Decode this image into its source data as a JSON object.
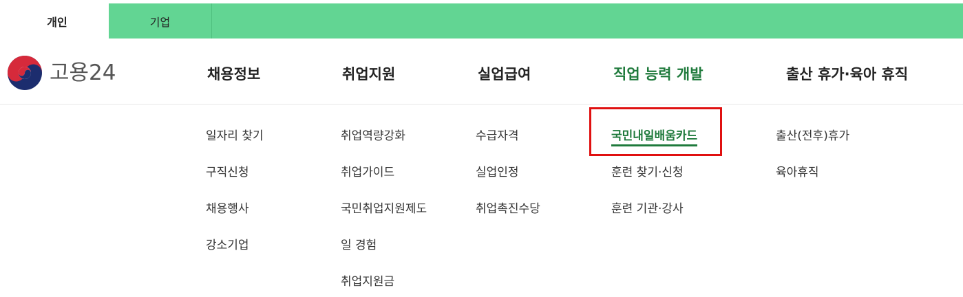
{
  "tabs": {
    "personal": "개인",
    "business": "기업"
  },
  "logo": {
    "text": "고용24"
  },
  "gnb": {
    "items": [
      "채용정보",
      "취업지원",
      "실업급여",
      "직업 능력 개발",
      "출산 휴가·육아 휴직"
    ],
    "active_index": 3
  },
  "submenu": {
    "col0": [
      "일자리 찾기",
      "구직신청",
      "채용행사",
      "강소기업"
    ],
    "col1": [
      "취업역량강화",
      "취업가이드",
      "국민취업지원제도",
      "일 경험",
      "취업지원금"
    ],
    "col2": [
      "수급자격",
      "실업인정",
      "취업촉진수당"
    ],
    "col3": [
      "국민내일배움카드",
      "훈련 찾기·신청",
      "훈련 기관·강사"
    ],
    "col4": [
      "출산(전후)휴가",
      "육아휴직"
    ]
  },
  "colors": {
    "tab_bar": "#62d593",
    "accent_green": "#1f7a3c",
    "highlight_red": "#e01010"
  }
}
